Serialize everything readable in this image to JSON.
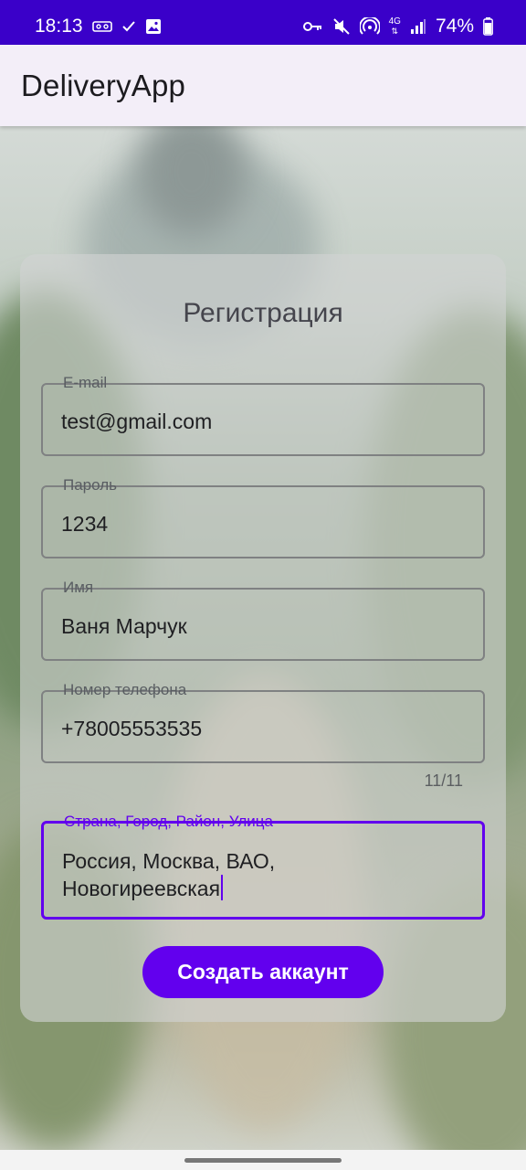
{
  "status_bar": {
    "time": "18:13",
    "battery": "74%",
    "left_icons": [
      "voicemail-icon",
      "check-icon",
      "image-icon"
    ],
    "right_icons": [
      "key-icon",
      "mute-icon",
      "hotspot-icon",
      "network-4g-icon",
      "signal-icon",
      "battery-icon"
    ],
    "network_label": "4G"
  },
  "app_bar": {
    "title": "DeliveryApp"
  },
  "form": {
    "title": "Регистрация",
    "email": {
      "label": "E-mail",
      "value": "test@gmail.com"
    },
    "password": {
      "label": "Пароль",
      "value": "1234"
    },
    "name": {
      "label": "Имя",
      "value": "Ваня Марчук"
    },
    "phone": {
      "label": "Номер телефона",
      "value": "+78005553535",
      "counter": "11/11"
    },
    "address": {
      "label": "Страна, Город, Район, Улица",
      "value_line1": "Россия, Москва, ВАО,",
      "value_line2": "Новогиреевская"
    },
    "submit_label": "Создать аккаунт"
  },
  "colors": {
    "accent": "#6200ee",
    "status_bar": "#3a00c9",
    "app_bar": "#f3eef8"
  }
}
